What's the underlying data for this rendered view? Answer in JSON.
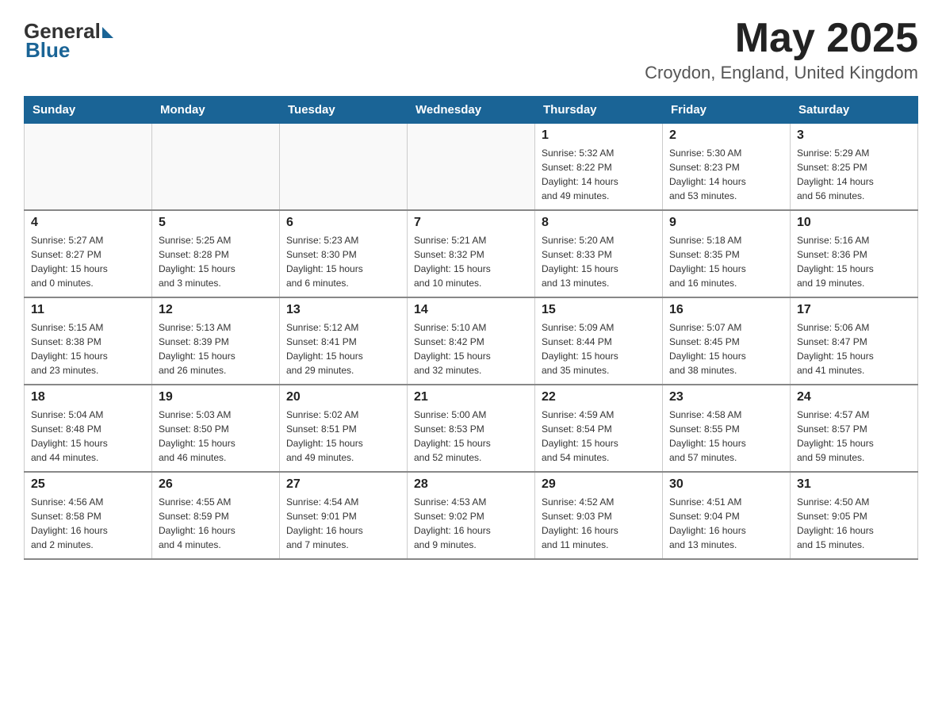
{
  "logo": {
    "general": "General",
    "blue": "Blue"
  },
  "header": {
    "month_year": "May 2025",
    "location": "Croydon, England, United Kingdom"
  },
  "days_of_week": [
    "Sunday",
    "Monday",
    "Tuesday",
    "Wednesday",
    "Thursday",
    "Friday",
    "Saturday"
  ],
  "weeks": [
    [
      {
        "day": "",
        "info": ""
      },
      {
        "day": "",
        "info": ""
      },
      {
        "day": "",
        "info": ""
      },
      {
        "day": "",
        "info": ""
      },
      {
        "day": "1",
        "info": "Sunrise: 5:32 AM\nSunset: 8:22 PM\nDaylight: 14 hours\nand 49 minutes."
      },
      {
        "day": "2",
        "info": "Sunrise: 5:30 AM\nSunset: 8:23 PM\nDaylight: 14 hours\nand 53 minutes."
      },
      {
        "day": "3",
        "info": "Sunrise: 5:29 AM\nSunset: 8:25 PM\nDaylight: 14 hours\nand 56 minutes."
      }
    ],
    [
      {
        "day": "4",
        "info": "Sunrise: 5:27 AM\nSunset: 8:27 PM\nDaylight: 15 hours\nand 0 minutes."
      },
      {
        "day": "5",
        "info": "Sunrise: 5:25 AM\nSunset: 8:28 PM\nDaylight: 15 hours\nand 3 minutes."
      },
      {
        "day": "6",
        "info": "Sunrise: 5:23 AM\nSunset: 8:30 PM\nDaylight: 15 hours\nand 6 minutes."
      },
      {
        "day": "7",
        "info": "Sunrise: 5:21 AM\nSunset: 8:32 PM\nDaylight: 15 hours\nand 10 minutes."
      },
      {
        "day": "8",
        "info": "Sunrise: 5:20 AM\nSunset: 8:33 PM\nDaylight: 15 hours\nand 13 minutes."
      },
      {
        "day": "9",
        "info": "Sunrise: 5:18 AM\nSunset: 8:35 PM\nDaylight: 15 hours\nand 16 minutes."
      },
      {
        "day": "10",
        "info": "Sunrise: 5:16 AM\nSunset: 8:36 PM\nDaylight: 15 hours\nand 19 minutes."
      }
    ],
    [
      {
        "day": "11",
        "info": "Sunrise: 5:15 AM\nSunset: 8:38 PM\nDaylight: 15 hours\nand 23 minutes."
      },
      {
        "day": "12",
        "info": "Sunrise: 5:13 AM\nSunset: 8:39 PM\nDaylight: 15 hours\nand 26 minutes."
      },
      {
        "day": "13",
        "info": "Sunrise: 5:12 AM\nSunset: 8:41 PM\nDaylight: 15 hours\nand 29 minutes."
      },
      {
        "day": "14",
        "info": "Sunrise: 5:10 AM\nSunset: 8:42 PM\nDaylight: 15 hours\nand 32 minutes."
      },
      {
        "day": "15",
        "info": "Sunrise: 5:09 AM\nSunset: 8:44 PM\nDaylight: 15 hours\nand 35 minutes."
      },
      {
        "day": "16",
        "info": "Sunrise: 5:07 AM\nSunset: 8:45 PM\nDaylight: 15 hours\nand 38 minutes."
      },
      {
        "day": "17",
        "info": "Sunrise: 5:06 AM\nSunset: 8:47 PM\nDaylight: 15 hours\nand 41 minutes."
      }
    ],
    [
      {
        "day": "18",
        "info": "Sunrise: 5:04 AM\nSunset: 8:48 PM\nDaylight: 15 hours\nand 44 minutes."
      },
      {
        "day": "19",
        "info": "Sunrise: 5:03 AM\nSunset: 8:50 PM\nDaylight: 15 hours\nand 46 minutes."
      },
      {
        "day": "20",
        "info": "Sunrise: 5:02 AM\nSunset: 8:51 PM\nDaylight: 15 hours\nand 49 minutes."
      },
      {
        "day": "21",
        "info": "Sunrise: 5:00 AM\nSunset: 8:53 PM\nDaylight: 15 hours\nand 52 minutes."
      },
      {
        "day": "22",
        "info": "Sunrise: 4:59 AM\nSunset: 8:54 PM\nDaylight: 15 hours\nand 54 minutes."
      },
      {
        "day": "23",
        "info": "Sunrise: 4:58 AM\nSunset: 8:55 PM\nDaylight: 15 hours\nand 57 minutes."
      },
      {
        "day": "24",
        "info": "Sunrise: 4:57 AM\nSunset: 8:57 PM\nDaylight: 15 hours\nand 59 minutes."
      }
    ],
    [
      {
        "day": "25",
        "info": "Sunrise: 4:56 AM\nSunset: 8:58 PM\nDaylight: 16 hours\nand 2 minutes."
      },
      {
        "day": "26",
        "info": "Sunrise: 4:55 AM\nSunset: 8:59 PM\nDaylight: 16 hours\nand 4 minutes."
      },
      {
        "day": "27",
        "info": "Sunrise: 4:54 AM\nSunset: 9:01 PM\nDaylight: 16 hours\nand 7 minutes."
      },
      {
        "day": "28",
        "info": "Sunrise: 4:53 AM\nSunset: 9:02 PM\nDaylight: 16 hours\nand 9 minutes."
      },
      {
        "day": "29",
        "info": "Sunrise: 4:52 AM\nSunset: 9:03 PM\nDaylight: 16 hours\nand 11 minutes."
      },
      {
        "day": "30",
        "info": "Sunrise: 4:51 AM\nSunset: 9:04 PM\nDaylight: 16 hours\nand 13 minutes."
      },
      {
        "day": "31",
        "info": "Sunrise: 4:50 AM\nSunset: 9:05 PM\nDaylight: 16 hours\nand 15 minutes."
      }
    ]
  ]
}
